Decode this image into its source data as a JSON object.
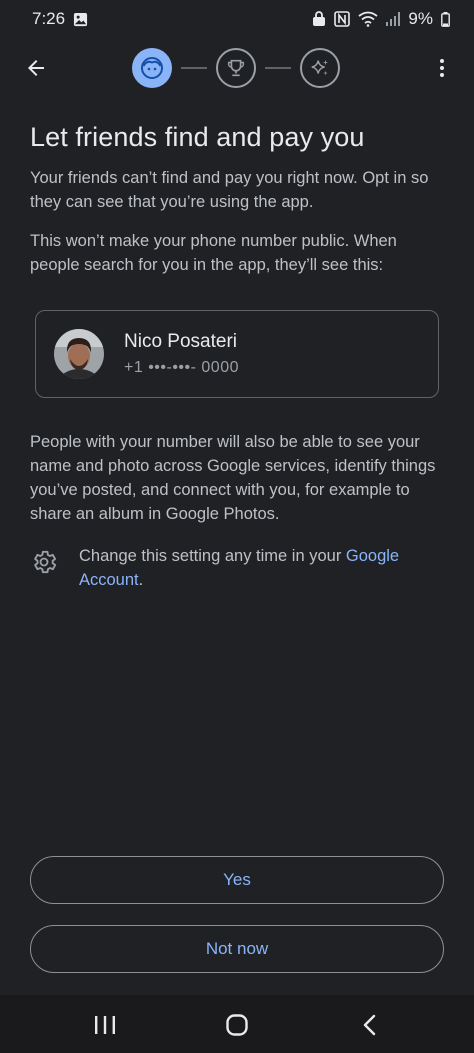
{
  "status_bar": {
    "time": "7:26",
    "battery": "9%",
    "icons": [
      "gallery-icon",
      "lock-icon",
      "nfc-icon",
      "wifi-icon",
      "signal-icon",
      "battery-icon"
    ]
  },
  "top_bar": {
    "back_icon": "arrow-back-icon",
    "overflow_icon": "more-vert-icon",
    "steps": [
      {
        "icon": "face-icon",
        "state": "active"
      },
      {
        "icon": "trophy-icon",
        "state": "inactive"
      },
      {
        "icon": "sparkle-icon",
        "state": "inactive"
      }
    ]
  },
  "main": {
    "title": "Let friends find and pay you",
    "intro": "Your friends can’t find and pay you right now. Opt in so they can see that you’re using the app.",
    "privacy_note": "This won’t make your phone number public. When people search for you in the app, they’ll see this:",
    "profile": {
      "name": "Nico Posateri",
      "phone": "+1 •••-•••- 0000"
    },
    "services_note": "People with your number will also be able to see your name and photo across Google services, identify things you’ve posted, and connect with you, for example to share an album in Google Photos.",
    "setting": {
      "prefix": "Change this setting any time in your ",
      "link": "Google Account",
      "suffix": "."
    }
  },
  "actions": {
    "yes_label": "Yes",
    "not_now_label": "Not now"
  },
  "nav": {
    "icons": [
      "recents-icon",
      "home-icon",
      "back-icon"
    ]
  },
  "colors": {
    "background": "#202124",
    "accent": "#8ab4f8",
    "text_primary": "#e8eaed",
    "text_secondary": "#bdc1c6"
  }
}
